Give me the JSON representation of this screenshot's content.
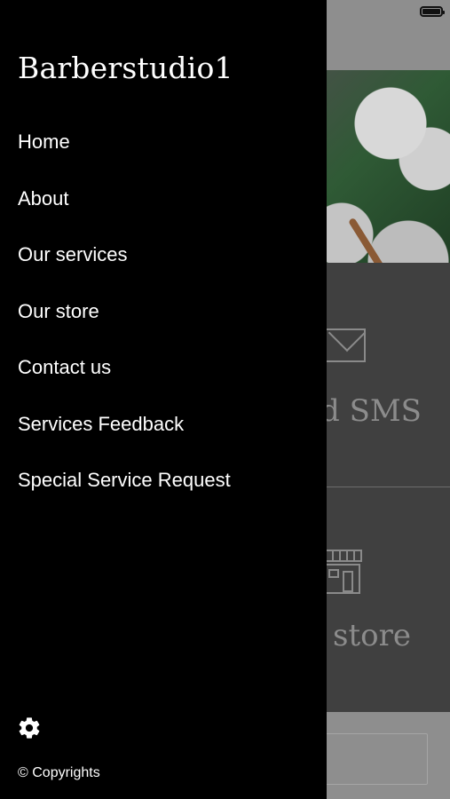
{
  "drawer": {
    "title": "Barberstudio1",
    "menu": [
      {
        "label": "Home"
      },
      {
        "label": "About"
      },
      {
        "label": "Our services"
      },
      {
        "label": "Our store"
      },
      {
        "label": "Contact us"
      },
      {
        "label": "Services Feedback"
      },
      {
        "label": "Special Service Request"
      }
    ],
    "settings_icon": "gear-icon",
    "copyright": "© Copyrights"
  },
  "background": {
    "tiles": [
      {
        "label": "d SMS",
        "icon": "envelope-icon"
      },
      {
        "label": "store",
        "icon": "storefront-icon"
      }
    ]
  },
  "colors": {
    "drawer_bg": "#000000",
    "drawer_text": "#ffffff",
    "overlay_tile": "#404040"
  }
}
